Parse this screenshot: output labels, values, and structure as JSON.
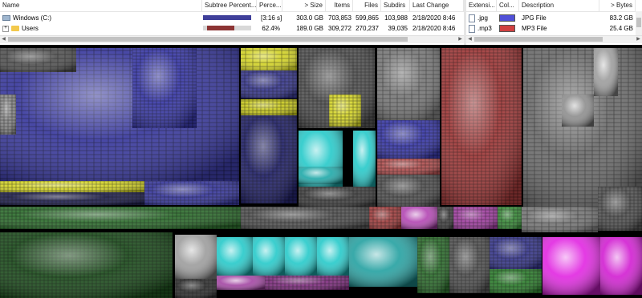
{
  "directory_list": {
    "columns": [
      "Name",
      "Subtree Percent...",
      "Perce...",
      "> Size",
      "Items",
      "Files",
      "Subdirs",
      "Last Change"
    ],
    "rows": [
      {
        "name": "Windows (C:)",
        "subtree": "[3:16 s]",
        "percent": "",
        "size": "303.0 GB",
        "items": "703,853",
        "files": "599,865",
        "subdirs": "103,988",
        "last_change": "2/18/2020 8:46",
        "bar_color": "#3f3f9a",
        "bar_fraction": 1.0
      },
      {
        "name": "Users",
        "subtree": "",
        "percent": "62.4%",
        "size": "189.0 GB",
        "items": "309,272",
        "files": "270,237",
        "subdirs": "39,035",
        "last_change": "2/18/2020 8:46",
        "bar_color": "#8c3434",
        "bar_fraction": 0.624
      }
    ],
    "expander_symbol": "+"
  },
  "extension_list": {
    "columns": [
      "Extensi...",
      "Col...",
      "Description",
      "> Bytes"
    ],
    "rows": [
      {
        "ext": ".jpg",
        "color": "#5050d8",
        "description": "JPG File",
        "bytes": "83.2 GB"
      },
      {
        "ext": ".mp3",
        "color": "#d04040",
        "description": "MP3 File",
        "bytes": "25.4 GB"
      },
      {
        "ext": "",
        "color": "#40c040",
        "description": "",
        "bytes": ""
      }
    ]
  },
  "colors": {
    "jpg": "#3a3a9e",
    "mp3": "#a03a3a",
    "yellow": "#d4d42a",
    "cyan": "#20c8c8",
    "magenta": "#e020e0",
    "gray": "#8a8a8a",
    "green": "#3aa83a"
  }
}
